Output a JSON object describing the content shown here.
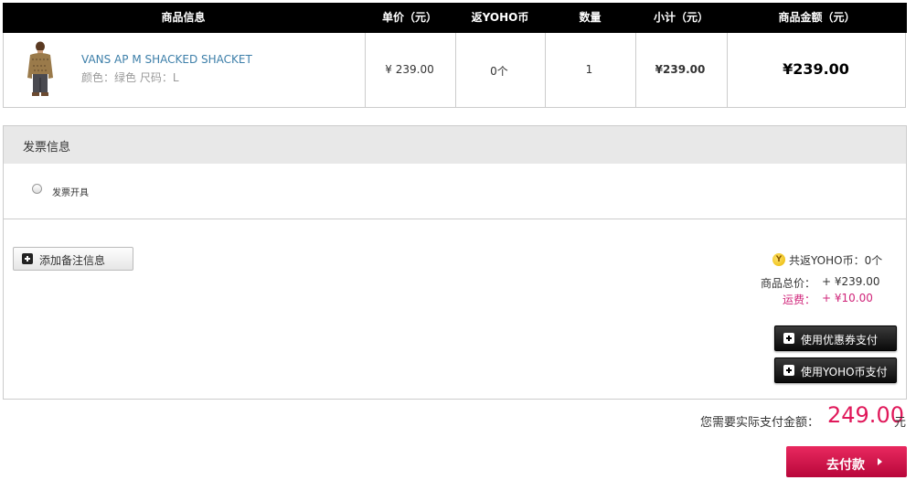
{
  "table": {
    "headers": [
      "商品信息",
      "单价（元）",
      "返YOHO币",
      "数量",
      "小计（元）",
      "商品金额（元）"
    ]
  },
  "product": {
    "name": "VANS AP M SHACKED SHACKET",
    "attributes": "颜色：绿色 尺码：L",
    "unit_price": "¥ 239.00",
    "yoho_coin": "0个",
    "quantity": "1",
    "subtotal": "¥239.00",
    "amount": "¥239.00",
    "image_icon": "jacket-photo"
  },
  "invoice": {
    "title": "发票信息",
    "option_label": "发票开具"
  },
  "remark": {
    "button_label": "添加备注信息"
  },
  "summary": {
    "coin_icon": "yoho-coin-icon",
    "coin_text": "共返YOHO币：0个",
    "goods_total_label": "商品总价：",
    "goods_total_value": "+ ¥239.00",
    "shipping_label": "运费：",
    "shipping_value": "+ ¥10.00",
    "coupon_button": "使用优惠券支付",
    "yoho_coin_button": "使用YOHO币支付"
  },
  "payment": {
    "label": "您需要实际支付金额：",
    "amount": "249.00",
    "unit": "元",
    "checkout_label": "去付款"
  },
  "colors": {
    "accent": "#e0185a",
    "shipping": "#d0257a",
    "link": "#3d7fa9",
    "header_bg": "#000000"
  }
}
